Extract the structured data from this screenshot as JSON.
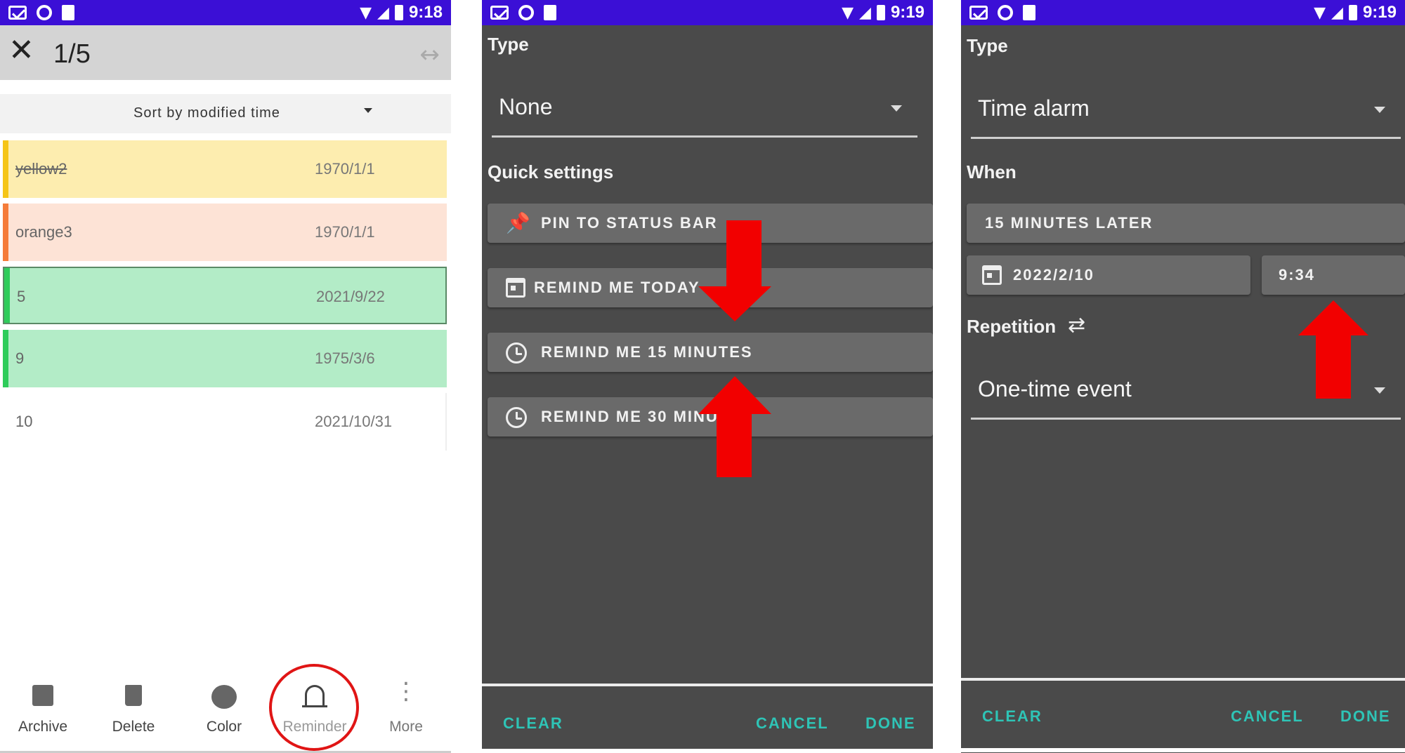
{
  "panel1": {
    "status_time": "9:18",
    "title": "1/5",
    "sort_label": "Sort by modified time",
    "notes": [
      {
        "title": "yellow2",
        "date": "1970/1/1",
        "bg": "#fdedaf",
        "bar": "#f5c518",
        "strike": true
      },
      {
        "title": "orange3",
        "date": "1970/1/1",
        "bg": "#fde3d6",
        "bar": "#f57c3a",
        "strike": false
      },
      {
        "title": "5",
        "date": "2021/9/22",
        "bg": "#b3ecc7",
        "bar": "#2ecc5a",
        "strike": false,
        "selected": true
      },
      {
        "title": "9",
        "date": "1975/3/6",
        "bg": "#b3ecc7",
        "bar": "#2ecc5a",
        "strike": false
      },
      {
        "title": "10",
        "date": "2021/10/31",
        "bg": "#ffffff",
        "bar": "#ffffff",
        "strike": false
      }
    ],
    "bottom_nav": [
      {
        "label": "Archive",
        "icon": "archive-icon"
      },
      {
        "label": "Delete",
        "icon": "delete-icon"
      },
      {
        "label": "Color",
        "icon": "palette-icon"
      },
      {
        "label": "Reminder",
        "icon": "bell-icon"
      },
      {
        "label": "More",
        "icon": "more-vert-icon"
      }
    ]
  },
  "panel2": {
    "status_time": "9:19",
    "type_label": "Type",
    "type_value": "None",
    "quick_label": "Quick settings",
    "buttons": {
      "pin": "PIN TO STATUS BAR",
      "today": "REMIND ME TODAY",
      "m15": "REMIND ME 15 MINUTES",
      "m30": "REMIND ME 30 MINUT"
    },
    "footer": {
      "clear": "CLEAR",
      "cancel": "CANCEL",
      "done": "DONE"
    }
  },
  "panel3": {
    "status_time": "9:19",
    "type_label": "Type",
    "type_value": "Time alarm",
    "when_label": "When",
    "later_button": "15 MINUTES LATER",
    "date_value": "2022/2/10",
    "time_value": "9:34",
    "repetition_label": "Repetition",
    "repetition_value": "One-time event",
    "footer": {
      "clear": "CLEAR",
      "cancel": "CANCEL",
      "done": "DONE"
    }
  },
  "colors": {
    "status_bar": "#3b0fd6",
    "dialog_bg": "#4a4a4a",
    "accent": "#2ec4b6",
    "annotation_red": "#f20000"
  }
}
